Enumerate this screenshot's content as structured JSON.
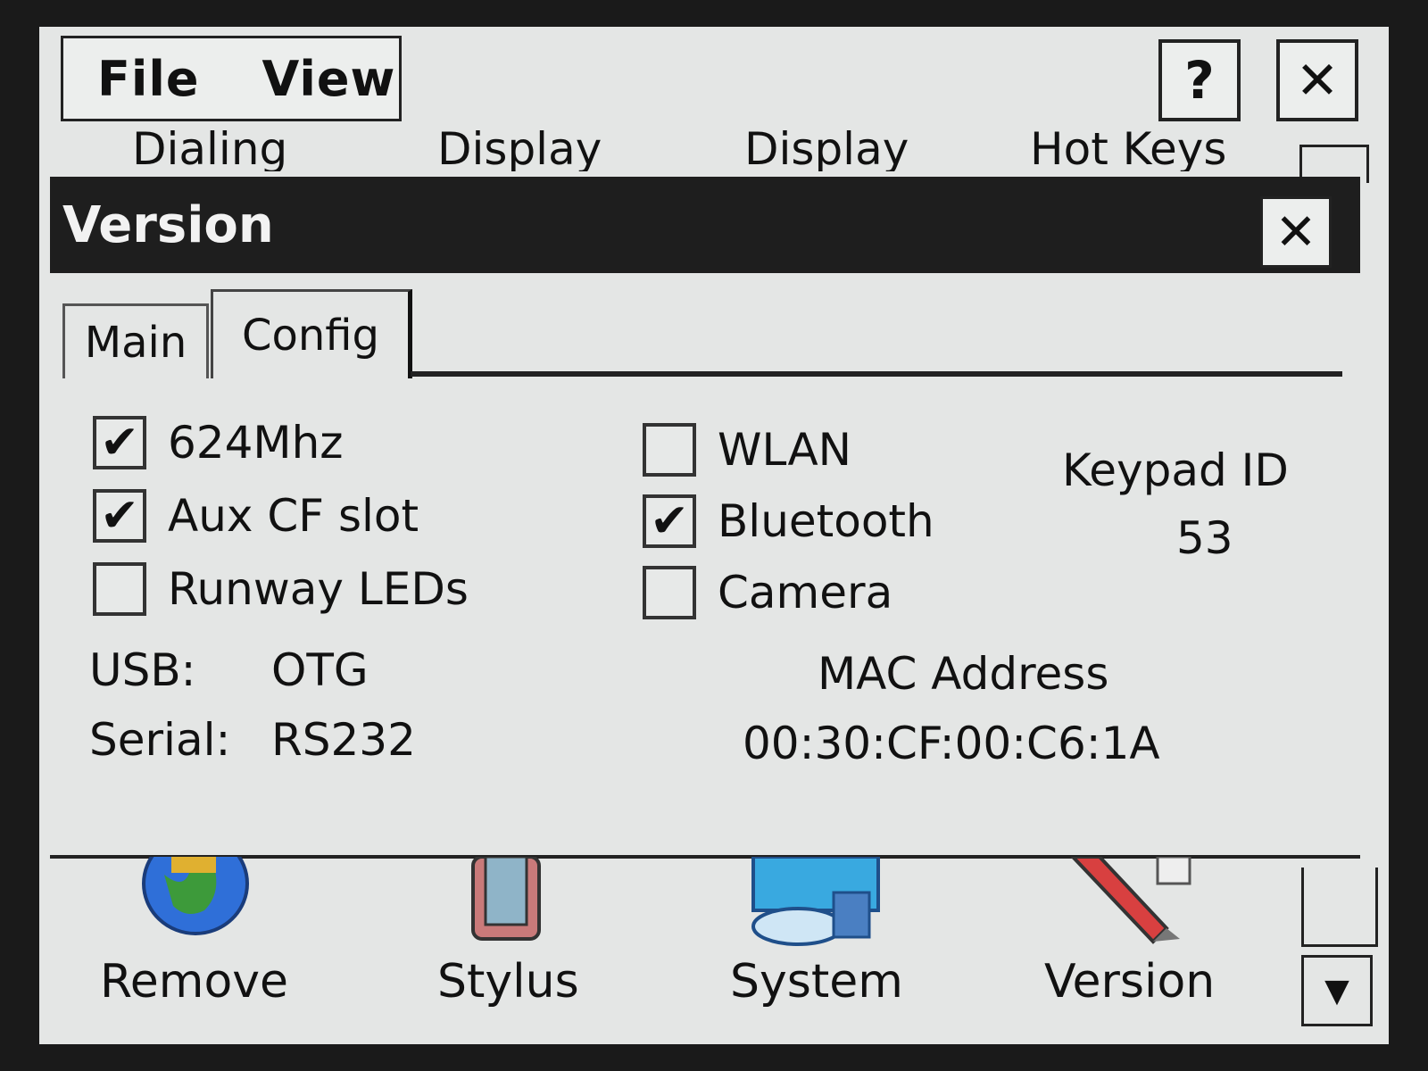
{
  "menubar": {
    "file": "File",
    "view": "View"
  },
  "top_buttons": {
    "help": "?",
    "close": "✕"
  },
  "control_panel_top_labels": [
    "Dialing",
    "Display",
    "Display",
    "Hot Keys"
  ],
  "dialog": {
    "title": "Version",
    "close": "✕",
    "tabs": [
      {
        "label": "Main",
        "selected": false
      },
      {
        "label": "Config",
        "selected": true
      }
    ],
    "checkboxes_left": [
      {
        "label": "624Mhz",
        "checked": true,
        "mark": "✔"
      },
      {
        "label": "Aux CF slot",
        "checked": true,
        "mark": "✔"
      },
      {
        "label": "Runway LEDs",
        "checked": false,
        "mark": ""
      }
    ],
    "checkboxes_right": [
      {
        "label": "WLAN",
        "checked": false,
        "mark": ""
      },
      {
        "label": "Bluetooth",
        "checked": true,
        "mark": "✔"
      },
      {
        "label": "Camera",
        "checked": false,
        "mark": ""
      }
    ],
    "usb": {
      "label": "USB:",
      "value": "OTG"
    },
    "serial": {
      "label": "Serial:",
      "value": "RS232"
    },
    "keypad": {
      "label": "Keypad ID",
      "value": "53"
    },
    "mac": {
      "label": "MAC Address",
      "value": "00:30:CF:00:C6:1A"
    }
  },
  "control_panel_bottom_items": [
    {
      "label": "Remove",
      "icon": "globe-icon"
    },
    {
      "label": "Stylus",
      "icon": "stylus-icon"
    },
    {
      "label": "System",
      "icon": "system-icon"
    },
    {
      "label": "Version",
      "icon": "version-icon"
    }
  ],
  "scroll_down": "▼",
  "colors": {
    "screen_bg": "#e4e6e5",
    "title_bar": "#1e1e1e",
    "frame": "#1a1a1a"
  }
}
